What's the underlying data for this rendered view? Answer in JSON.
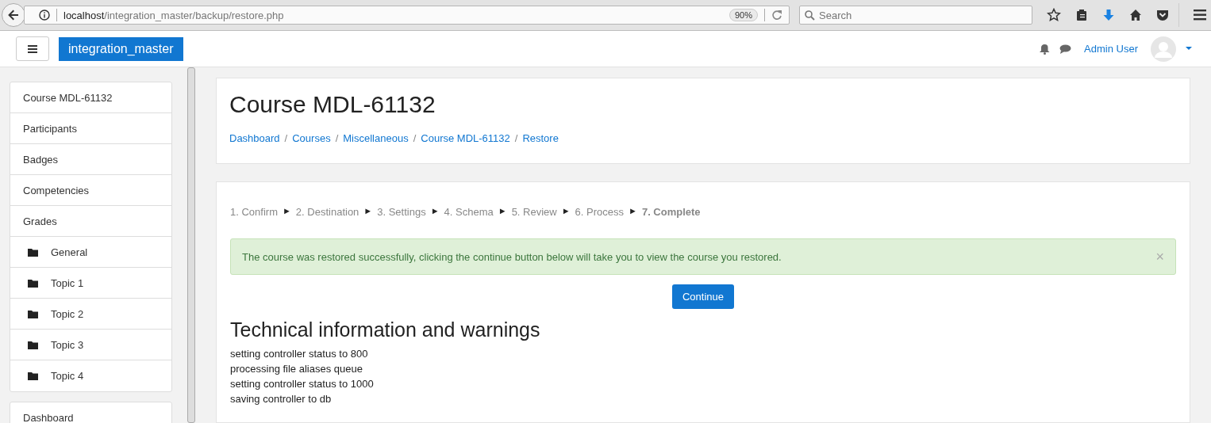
{
  "browser": {
    "url_host": "localhost",
    "url_path": "/integration_master/backup/restore.php",
    "zoom": "90%",
    "search_placeholder": "Search"
  },
  "navbar": {
    "site_name": "integration_master",
    "user_name": "Admin User"
  },
  "sidebar": {
    "blocks": [
      {
        "items": [
          {
            "label": "Course MDL-61132",
            "kind": "plain"
          },
          {
            "label": "Participants",
            "kind": "plain"
          },
          {
            "label": "Badges",
            "kind": "plain"
          },
          {
            "label": "Competencies",
            "kind": "plain"
          },
          {
            "label": "Grades",
            "kind": "plain"
          },
          {
            "label": "General",
            "kind": "folder"
          },
          {
            "label": "Topic 1",
            "kind": "folder"
          },
          {
            "label": "Topic 2",
            "kind": "folder"
          },
          {
            "label": "Topic 3",
            "kind": "folder"
          },
          {
            "label": "Topic 4",
            "kind": "folder"
          }
        ]
      },
      {
        "items": [
          {
            "label": "Dashboard",
            "kind": "plain"
          }
        ]
      }
    ]
  },
  "header": {
    "title": "Course MDL-61132",
    "breadcrumb": [
      "Dashboard",
      "Courses",
      "Miscellaneous",
      "Course MDL-61132",
      "Restore"
    ],
    "separator": "/"
  },
  "steps": {
    "separator": "►",
    "items": [
      {
        "label": "1. Confirm",
        "selected": false
      },
      {
        "label": "2. Destination",
        "selected": false
      },
      {
        "label": "3. Settings",
        "selected": false
      },
      {
        "label": "4. Schema",
        "selected": false
      },
      {
        "label": "5. Review",
        "selected": false
      },
      {
        "label": "6. Process",
        "selected": false
      },
      {
        "label": "7. Complete",
        "selected": true
      }
    ]
  },
  "alert": {
    "message": "The course was restored successfully, clicking the continue button below will take you to view the course you restored.",
    "close": "×"
  },
  "continue_button": "Continue",
  "tech": {
    "heading": "Technical information and warnings",
    "lines": [
      "setting controller status to 800",
      "processing file aliases queue",
      "setting controller status to 1000",
      "saving controller to db"
    ]
  }
}
